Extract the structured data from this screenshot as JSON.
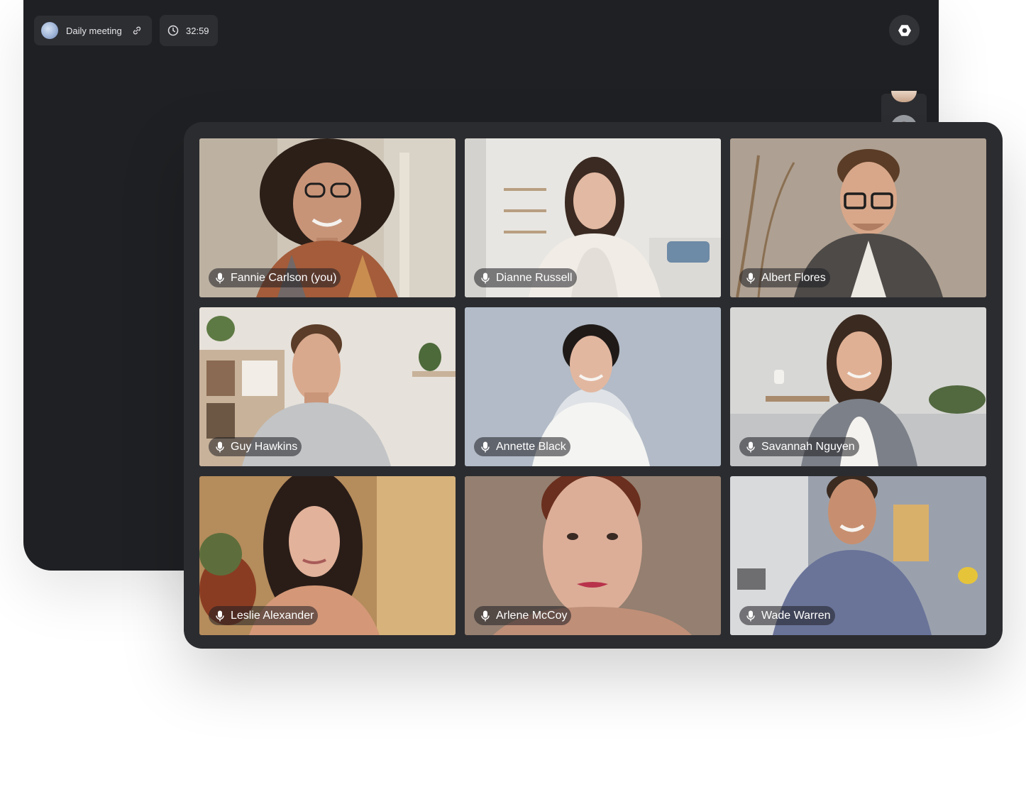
{
  "meeting": {
    "title": "Daily meeting",
    "timer": "32:59"
  },
  "icons": {
    "link": "link-icon",
    "clock": "clock-icon",
    "settings": "settings-icon",
    "mic": "microphone-icon"
  },
  "colors": {
    "window_bg": "#1f2023",
    "card_bg": "#2b2c30",
    "pill_bg": "#2d2e32",
    "text": "#e8e8ea"
  },
  "participants": [
    {
      "name": "Fannie Carlson (you)"
    },
    {
      "name": "Dianne Russell"
    },
    {
      "name": "Albert Flores"
    },
    {
      "name": "Guy Hawkins"
    },
    {
      "name": "Annette Black"
    },
    {
      "name": "Savannah Nguyen"
    },
    {
      "name": "Leslie Alexander"
    },
    {
      "name": "Arlene McCoy"
    },
    {
      "name": "Wade Warren"
    }
  ]
}
